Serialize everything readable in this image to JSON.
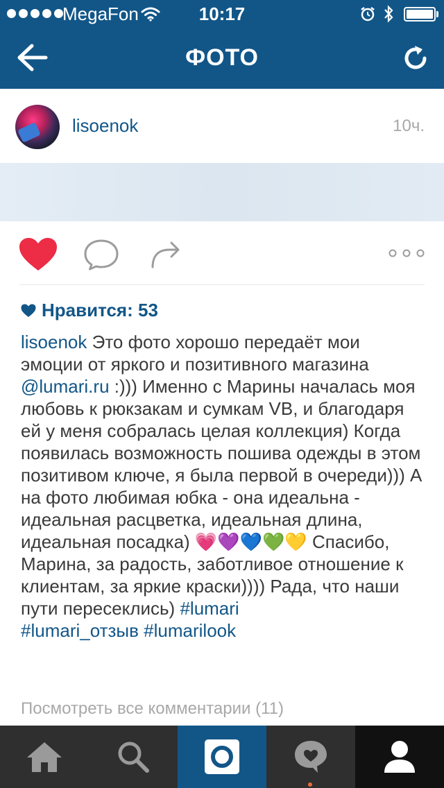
{
  "status_bar": {
    "carrier": "MegaFon",
    "time": "10:17",
    "battery_level": 0.95
  },
  "nav": {
    "title": "ФОТО",
    "back_icon": "arrow-left-icon",
    "refresh_icon": "refresh-icon"
  },
  "post": {
    "username": "lisoenok",
    "time_ago": "10ч.",
    "likes_label": "Нравится: 53",
    "caption_user": "lisoenok",
    "caption_part1": " Это фото хорошо передаёт мои эмоции от яркого и позитивного магазина ",
    "caption_mention": "@lumari.ru",
    "caption_part2": " :))) Именно с Марины началась моя любовь к рюкзакам и сумкам VB, и благодаря ей у меня собралась целая коллекция) Когда появилась возможность пошива одежды в этом позитивом ключе, я была первой в очереди))) А на фото любимая юбка - она идеальна - идеальная расцветка, идеальная длина, идеальная посадка) ",
    "caption_emoji": "💗💜💙💚💛",
    "caption_part3": " Спасибо, Марина, за радость, заботливое отношение к клиентам, за яркие краски)))) Рада, что наши пути пересеклись) ",
    "hashtag1": "#lumari",
    "hashtag2": "#lumari_отзыв",
    "hashtag3": "#lumarilook",
    "view_comments": "Посмотреть все комментарии (11)"
  },
  "colors": {
    "brand": "#125688",
    "like": "#ed2c46",
    "tabbar": "#2f2f2f"
  },
  "tabs": [
    {
      "name": "home-icon"
    },
    {
      "name": "search-icon"
    },
    {
      "name": "camera-icon"
    },
    {
      "name": "activity-icon"
    },
    {
      "name": "profile-icon"
    }
  ]
}
